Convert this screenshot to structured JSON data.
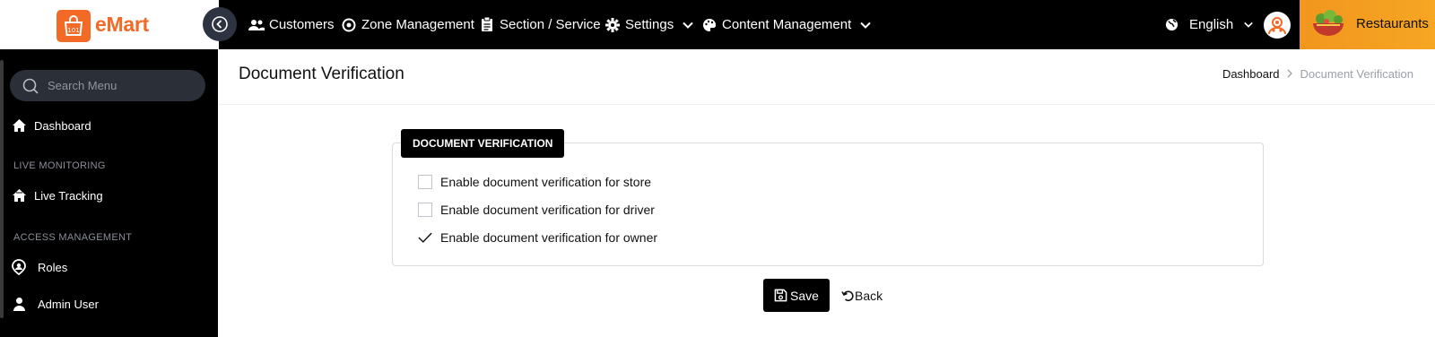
{
  "brand": {
    "name": "eMart",
    "accent": "#f26a26"
  },
  "topnav": {
    "items": [
      {
        "label": "Customers",
        "icon": "users-icon"
      },
      {
        "label": "Zone Management",
        "icon": "target-icon"
      },
      {
        "label": "Section / Service",
        "icon": "clipboard-icon"
      },
      {
        "label": "Settings",
        "icon": "gear-icon"
      },
      {
        "label": "Content Management",
        "icon": "palette-icon"
      }
    ],
    "language": "English",
    "section": "Restaurants"
  },
  "sidebar": {
    "search_placeholder": "Search Menu",
    "dashboard": "Dashboard",
    "live_monitoring_heading": "LIVE MONITORING",
    "live_tracking": "Live Tracking",
    "access_management_heading": "ACCESS MANAGEMENT",
    "roles": "Roles",
    "admin_user": "Admin User"
  },
  "page": {
    "title": "Document Verification",
    "breadcrumb": {
      "home": "Dashboard",
      "current": "Document Verification"
    }
  },
  "form": {
    "section_label": "DOCUMENT VERIFICATION",
    "options": [
      {
        "label": "Enable document verification for store",
        "checked": false
      },
      {
        "label": "Enable document verification for driver",
        "checked": false
      },
      {
        "label": "Enable document verification for owner",
        "checked": true
      }
    ],
    "save_label": "Save",
    "back_label": "Back"
  }
}
